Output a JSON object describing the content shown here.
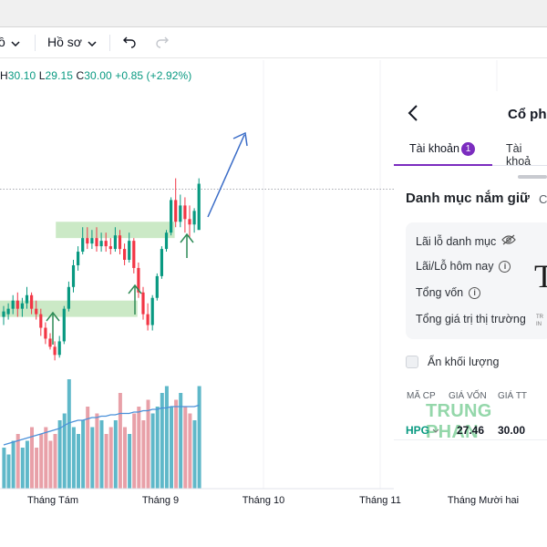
{
  "toolbar": {
    "partial_menu_label": "ồ",
    "profile_label": "Hồ sơ",
    "undo_icon": "undo-icon",
    "redo_icon": "redo-icon"
  },
  "legend": {
    "h_label": "H",
    "h_value": "30.10",
    "l_label": "L",
    "l_value": "29.15",
    "c_label": "C",
    "c_value": "30.00",
    "change": "+0.85 (+2.92%)"
  },
  "colors": {
    "up": "#089981",
    "down": "#f23645",
    "zone": "#a8dba0",
    "arrow_green": "#2e8b57",
    "arrow_blue": "#3a6cc7",
    "vol_up": "#5fb8c9",
    "vol_down": "#e8a0a8",
    "accent": "#7b2cbf"
  },
  "chart_data": {
    "type": "candlestick",
    "x_labels": [
      "Tháng Tám",
      "Tháng 9",
      "Tháng 10",
      "Tháng 11",
      "Tháng Mười hai"
    ],
    "ylim": [
      26.0,
      31.2
    ],
    "last_close_line": 29.9,
    "candles": [
      {
        "o": 27.55,
        "h": 27.75,
        "c": 27.65,
        "l": 27.4
      },
      {
        "o": 27.6,
        "h": 27.8,
        "c": 27.7,
        "l": 27.5
      },
      {
        "o": 27.7,
        "h": 27.95,
        "c": 27.85,
        "l": 27.6
      },
      {
        "o": 27.85,
        "h": 28.0,
        "c": 27.7,
        "l": 27.55
      },
      {
        "o": 27.7,
        "h": 27.9,
        "c": 27.8,
        "l": 27.55
      },
      {
        "o": 27.8,
        "h": 28.1,
        "c": 27.95,
        "l": 27.7
      },
      {
        "o": 27.95,
        "h": 28.0,
        "c": 27.7,
        "l": 27.6
      },
      {
        "o": 27.7,
        "h": 27.85,
        "c": 27.6,
        "l": 27.5
      },
      {
        "o": 27.6,
        "h": 27.7,
        "c": 27.35,
        "l": 27.2
      },
      {
        "o": 27.35,
        "h": 27.45,
        "c": 27.15,
        "l": 27.05
      },
      {
        "o": 27.15,
        "h": 27.25,
        "c": 27.0,
        "l": 26.95
      },
      {
        "o": 27.0,
        "h": 27.1,
        "c": 26.85,
        "l": 26.75
      },
      {
        "o": 26.85,
        "h": 27.2,
        "c": 27.1,
        "l": 26.8
      },
      {
        "o": 27.1,
        "h": 27.75,
        "c": 27.7,
        "l": 27.05
      },
      {
        "o": 27.7,
        "h": 28.2,
        "c": 28.1,
        "l": 27.65
      },
      {
        "o": 28.1,
        "h": 28.6,
        "c": 28.5,
        "l": 28.0
      },
      {
        "o": 28.5,
        "h": 28.85,
        "c": 28.75,
        "l": 28.4
      },
      {
        "o": 28.75,
        "h": 29.2,
        "c": 29.0,
        "l": 28.7
      },
      {
        "o": 29.0,
        "h": 29.2,
        "c": 28.9,
        "l": 28.8
      },
      {
        "o": 28.9,
        "h": 29.15,
        "c": 29.0,
        "l": 28.8
      },
      {
        "o": 29.0,
        "h": 29.2,
        "c": 28.85,
        "l": 28.75
      },
      {
        "o": 28.85,
        "h": 29.1,
        "c": 28.95,
        "l": 28.75
      },
      {
        "o": 28.95,
        "h": 29.1,
        "c": 28.85,
        "l": 28.75
      },
      {
        "o": 28.85,
        "h": 29.0,
        "c": 28.8,
        "l": 28.7
      },
      {
        "o": 28.8,
        "h": 29.2,
        "c": 29.05,
        "l": 28.75
      },
      {
        "o": 29.05,
        "h": 29.15,
        "c": 28.8,
        "l": 28.7
      },
      {
        "o": 28.8,
        "h": 28.9,
        "c": 28.6,
        "l": 28.5
      },
      {
        "o": 28.6,
        "h": 29.1,
        "c": 28.95,
        "l": 28.55
      },
      {
        "o": 28.95,
        "h": 29.0,
        "c": 28.45,
        "l": 28.35
      },
      {
        "o": 28.45,
        "h": 28.55,
        "c": 28.0,
        "l": 27.9
      },
      {
        "o": 28.0,
        "h": 28.1,
        "c": 27.6,
        "l": 27.5
      },
      {
        "o": 27.6,
        "h": 27.8,
        "c": 27.4,
        "l": 27.3
      },
      {
        "o": 27.4,
        "h": 27.95,
        "c": 27.9,
        "l": 27.3
      },
      {
        "o": 27.9,
        "h": 28.35,
        "c": 28.3,
        "l": 27.85
      },
      {
        "o": 28.3,
        "h": 28.85,
        "c": 28.8,
        "l": 28.25
      },
      {
        "o": 28.8,
        "h": 29.15,
        "c": 29.1,
        "l": 28.75
      },
      {
        "o": 29.1,
        "h": 29.75,
        "c": 29.7,
        "l": 29.05
      },
      {
        "o": 29.7,
        "h": 30.1,
        "c": 29.3,
        "l": 29.2
      },
      {
        "o": 29.3,
        "h": 29.8,
        "c": 29.6,
        "l": 29.2
      },
      {
        "o": 29.6,
        "h": 29.75,
        "c": 29.35,
        "l": 29.1
      },
      {
        "o": 29.35,
        "h": 29.6,
        "c": 29.25,
        "l": 29.0
      },
      {
        "o": 29.25,
        "h": 29.55,
        "c": 29.5,
        "l": 29.1
      },
      {
        "o": 29.15,
        "h": 30.1,
        "c": 30.0,
        "l": 29.15
      }
    ],
    "volume": [
      0.3,
      0.25,
      0.35,
      0.4,
      0.3,
      0.35,
      0.45,
      0.3,
      0.4,
      0.45,
      0.35,
      0.4,
      0.5,
      0.55,
      0.8,
      0.45,
      0.4,
      0.5,
      0.6,
      0.45,
      0.55,
      0.5,
      0.4,
      0.45,
      0.5,
      0.7,
      0.45,
      0.4,
      0.55,
      0.6,
      0.5,
      0.65,
      0.55,
      0.6,
      0.7,
      0.75,
      0.6,
      0.65,
      0.7,
      0.6,
      0.55,
      0.5,
      0.75
    ],
    "volume_ma": [
      0.32,
      0.33,
      0.34,
      0.35,
      0.36,
      0.37,
      0.38,
      0.39,
      0.4,
      0.41,
      0.42,
      0.43,
      0.44,
      0.46,
      0.48,
      0.49,
      0.5,
      0.5,
      0.51,
      0.52,
      0.52,
      0.53,
      0.53,
      0.54,
      0.54,
      0.55,
      0.55,
      0.55,
      0.56,
      0.56,
      0.57,
      0.57,
      0.58,
      0.58,
      0.59,
      0.59,
      0.6,
      0.6,
      0.6,
      0.6,
      0.6,
      0.6,
      0.61
    ],
    "zones": [
      {
        "from_index": 0,
        "to_index": 28,
        "low": 27.55,
        "high": 27.85
      },
      {
        "from_index": 12,
        "to_index": 36,
        "low": 29.0,
        "high": 29.3
      }
    ]
  },
  "panel": {
    "title": "Cổ ph",
    "tab_account": "Tài khoản",
    "tab_account_badge": "1",
    "tab_account_2": "Tài khoả",
    "section_title": "Danh mục nắm giữ",
    "section_title_cut": "C",
    "rows": [
      "Lãi lỗ danh mục",
      "Lãi/Lỗ hôm nay",
      "Tổng vốn",
      "Tổng giá trị thị trường"
    ],
    "hide_volume_label": "Ẩn khối lượng",
    "col_headers": [
      "MÃ CP",
      "GIÁ VỐN",
      "GIÁ TT"
    ],
    "watermark": "TRUNG PHAN",
    "holding": {
      "symbol": "HPG",
      "cost": "27.46",
      "price": "30.00"
    },
    "side_logo_letter": "T",
    "side_logo_caption": "TR IN"
  }
}
